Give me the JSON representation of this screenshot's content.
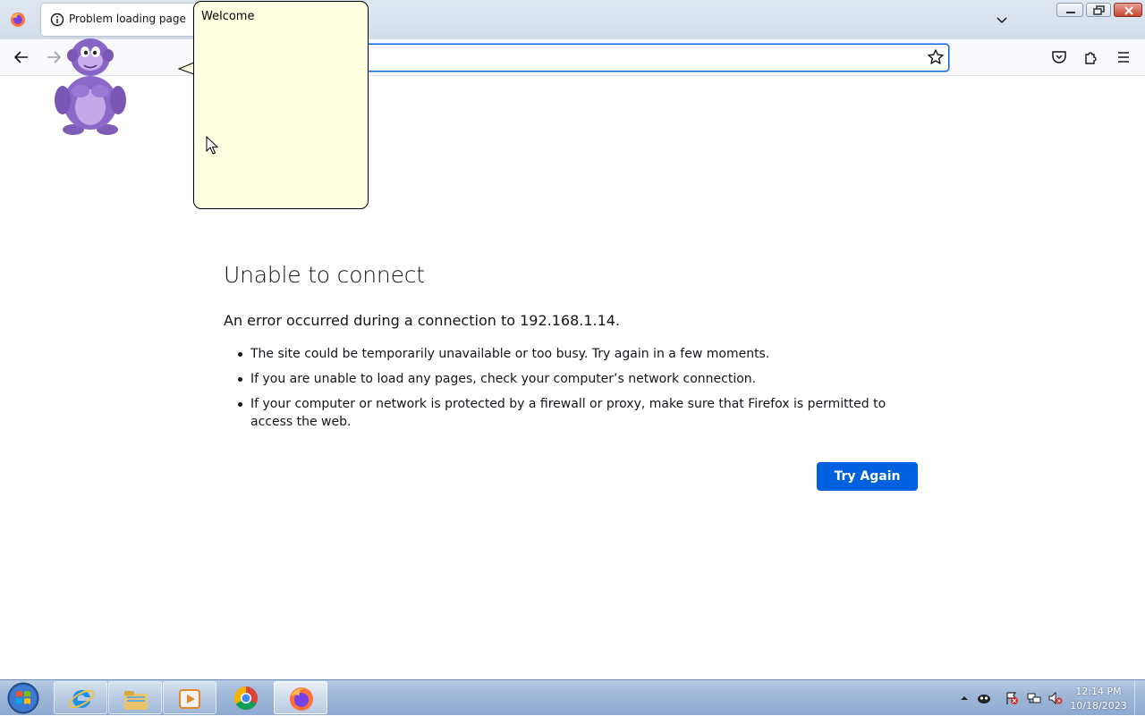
{
  "browser": {
    "tab": {
      "title": "Problem loading page",
      "icon": "info-icon"
    },
    "address_bar": {
      "url_fragment": "/"
    },
    "toolbar_icons": [
      "back-arrow-icon",
      "forward-arrow-icon",
      "bookmark-star-icon",
      "pocket-icon",
      "extensions-icon",
      "hamburger-menu-icon"
    ]
  },
  "error_page": {
    "title": "Unable to connect",
    "description": "An error occurred during a connection to 192.168.1.14.",
    "bullets": [
      "The site could be temporarily unavailable or too busy. Try again in a few moments.",
      "If you are unable to load any pages, check your computer’s network connection.",
      "If your computer or network is protected by a firewall or proxy, make sure that Firefox is permitted to access the web."
    ],
    "button_label": "Try Again",
    "button_color": "#0061e0"
  },
  "assistant": {
    "character": "purple-gorilla-assistant",
    "bubble_text": "Welcome",
    "bubble_color": "#ffffe1"
  },
  "taskbar": {
    "apps": [
      "internet-explorer-icon",
      "file-explorer-icon",
      "media-player-icon",
      "chrome-icon",
      "firefox-icon"
    ],
    "tray_icons": [
      "show-hidden-icons-arrow",
      "assistant-tray-icon",
      "action-center-flag-icon",
      "network-icon",
      "volume-muted-icon"
    ],
    "clock": {
      "time": "12:14 PM",
      "date": "10/18/2023"
    }
  }
}
